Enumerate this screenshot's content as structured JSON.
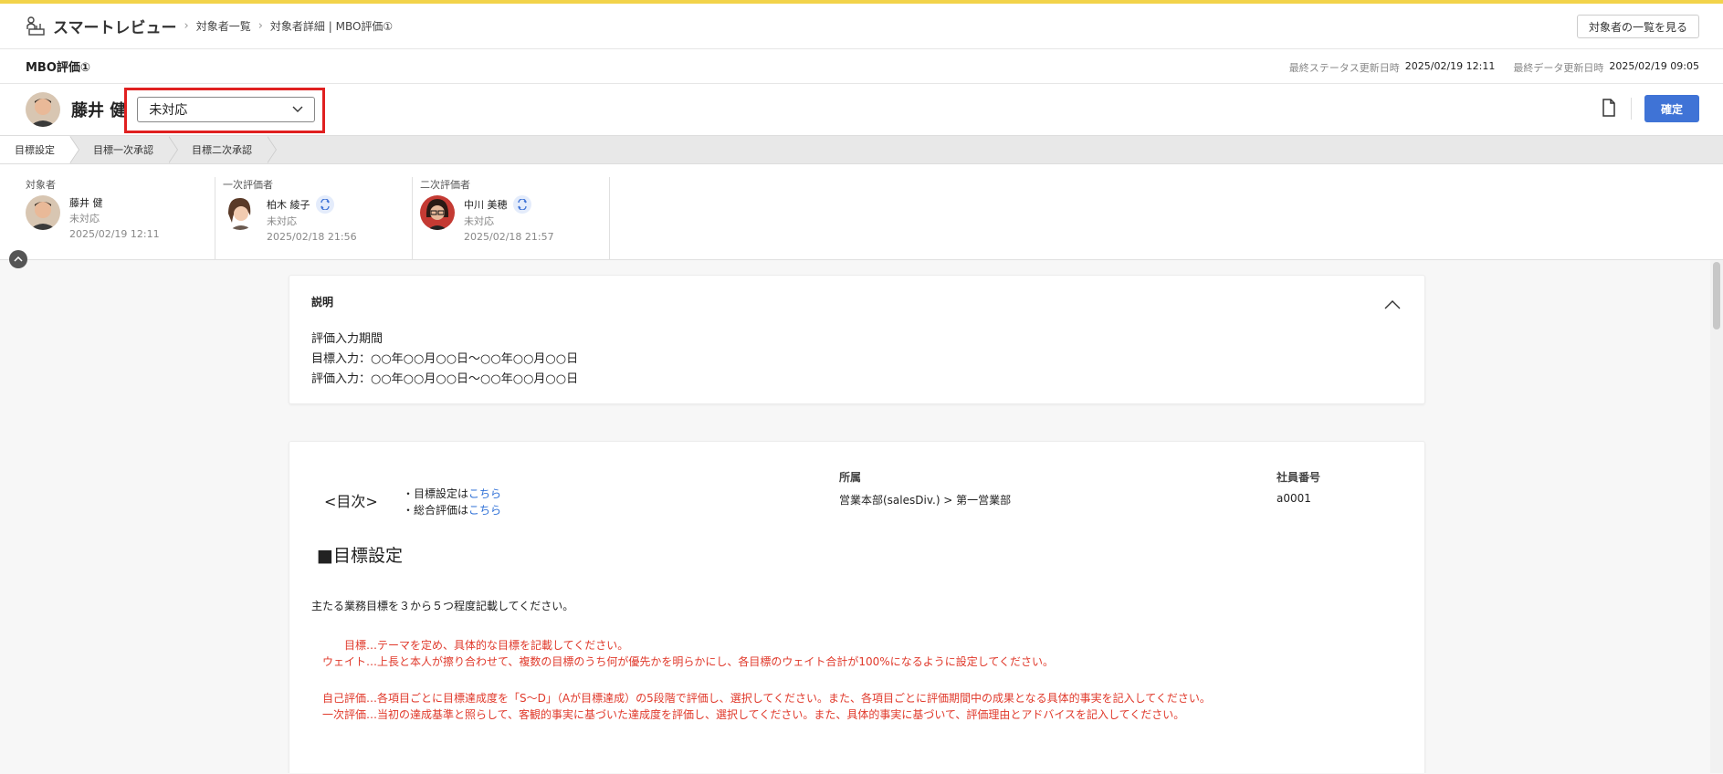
{
  "header": {
    "app_title": "スマートレビュー",
    "breadcrumbs": [
      "対象者一覧",
      "対象者詳細 | MBO評価①"
    ],
    "list_button": "対象者の一覧を見る"
  },
  "subheader": {
    "title": "MBO評価①",
    "status_updated_label": "最終ステータス更新日時",
    "status_updated_value": "2025/02/19 12:11",
    "data_updated_label": "最終データ更新日時",
    "data_updated_value": "2025/02/19 09:05"
  },
  "person": {
    "name": "藤井 健",
    "status": "未対応",
    "confirm_button": "確定"
  },
  "steps": [
    "目標設定",
    "目標一次承認",
    "目標二次承認"
  ],
  "evaluators": [
    {
      "role": "対象者",
      "name": "藤井 健",
      "status": "未対応",
      "date": "2025/02/19 12:11"
    },
    {
      "role": "一次評価者",
      "name": "柏木 綾子",
      "status": "未対応",
      "date": "2025/02/18 21:56"
    },
    {
      "role": "二次評価者",
      "name": "中川 美穂",
      "status": "未対応",
      "date": "2025/02/18 21:57"
    }
  ],
  "description": {
    "title": "説明",
    "lines": [
      "評価入力期間",
      "目標入力：○○年○○月○○日～○○年○○月○○日",
      "評価入力：○○年○○月○○日～○○年○○月○○日"
    ]
  },
  "form": {
    "toc_label": "<目次>",
    "toc1_prefix": "・目標設定は",
    "toc2_prefix": "・総合評価は",
    "toc_link": "こちら",
    "dept_label": "所属",
    "dept_value": "営業本部(salesDiv.) > 第一営業部",
    "emp_label": "社員番号",
    "emp_value": "a0001",
    "section_title": "■目標設定",
    "instruction": "主たる業務目標を３から５つ程度記載してください。",
    "red_lines_1": [
      "　　目標…テーマを定め、具体的な目標を記載してください。",
      "ウェイト…上長と本人が擦り合わせて、複数の目標のうち何が優先かを明らかにし、各目標のウェイト合計が100%になるように設定してください。"
    ],
    "red_lines_2": [
      "自己評価…各項目ごとに目標達成度を「S～D」（Aが目標達成）の5段階で評価し、選択してください。また、各項目ごとに評価期間中の成果となる具体的事実を記入してください。",
      "一次評価…当初の達成基準と照らして、客観的事実に基づいた達成度を評価し、選択してください。また、具体的事実に基づいて、評価理由とアドバイスを記入してください。"
    ]
  }
}
